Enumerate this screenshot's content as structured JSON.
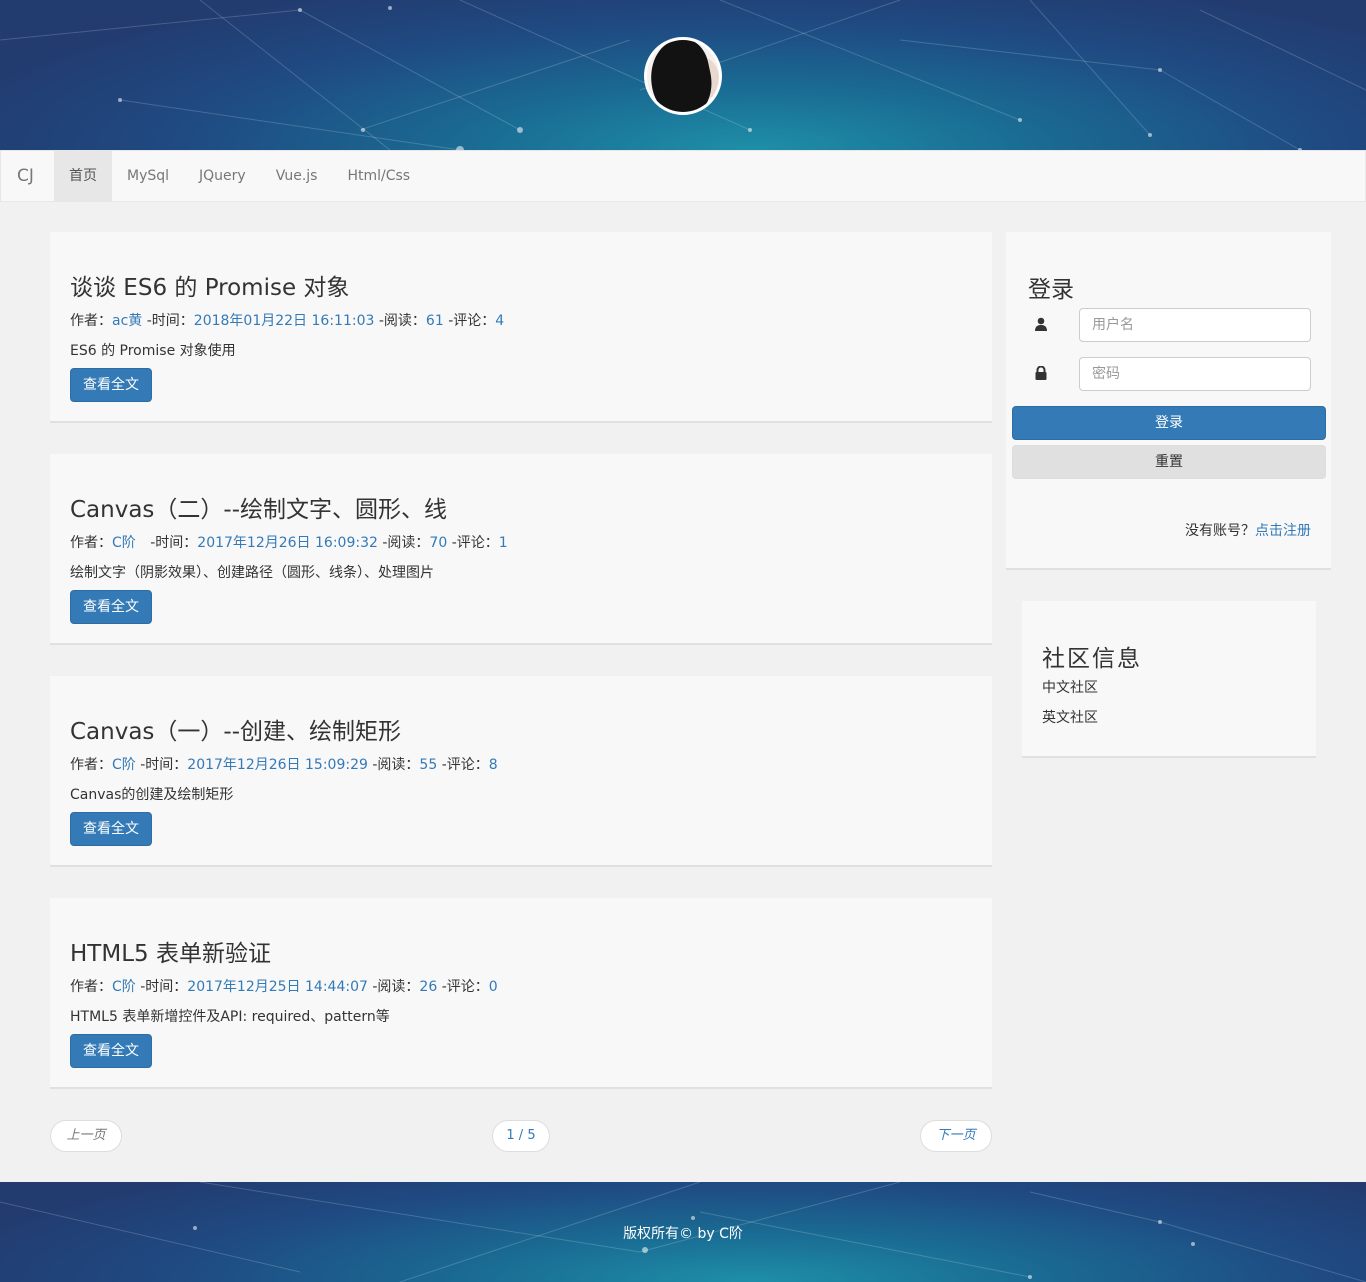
{
  "site": {
    "brand": "CJ",
    "nav": [
      {
        "label": "首页",
        "active": true
      },
      {
        "label": "MySql",
        "active": false
      },
      {
        "label": "JQuery",
        "active": false
      },
      {
        "label": "Vue.js",
        "active": false
      },
      {
        "label": "Html/Css",
        "active": false
      }
    ]
  },
  "articles": [
    {
      "title": "谈谈 ES6 的 Promise 对象",
      "author_label": "作者：",
      "author": "ac黄",
      "time_label": "-时间：",
      "time": "2018年01月22日 16:11:03",
      "reads_label": "-阅读：",
      "reads": "61",
      "comments_label": "-评论：",
      "comments": "4",
      "summary": "ES6 的 Promise 对象使用",
      "button": "查看全文"
    },
    {
      "title": "Canvas（二）--绘制文字、圆形、线",
      "author_label": "作者：",
      "author": "C阶",
      "time_label": "-时间：",
      "time": "2017年12月26日 16:09:32",
      "reads_label": "-阅读：",
      "reads": "70",
      "comments_label": "-评论：",
      "comments": "1",
      "summary": "绘制文字（阴影效果）、创建路径（圆形、线条）、处理图片",
      "button": "查看全文"
    },
    {
      "title": "Canvas（一）--创建、绘制矩形",
      "author_label": "作者：",
      "author": "C阶",
      "time_label": "-时间：",
      "time": "2017年12月26日 15:09:29",
      "reads_label": "-阅读：",
      "reads": "55",
      "comments_label": "-评论：",
      "comments": "8",
      "summary": "Canvas的创建及绘制矩形",
      "button": "查看全文"
    },
    {
      "title": "HTML5 表单新验证",
      "author_label": "作者：",
      "author": "C阶",
      "time_label": "-时间：",
      "time": "2017年12月25日 14:44:07",
      "reads_label": "-阅读：",
      "reads": "26",
      "comments_label": "-评论：",
      "comments": "0",
      "summary": "HTML5 表单新增控件及API: required、pattern等",
      "button": "查看全文"
    }
  ],
  "pager": {
    "prev": "上一页",
    "current": "1 / 5",
    "next": "下一页"
  },
  "login": {
    "title": "登录",
    "username_placeholder": "用户名",
    "password_placeholder": "密码",
    "login_button": "登录",
    "reset_button": "重置",
    "no_account": "没有账号？",
    "register_link": "点击注册"
  },
  "community": {
    "title": "社区信息",
    "items": [
      "中文社区",
      "英文社区"
    ]
  },
  "footer": {
    "copyright": "版权所有© by C阶"
  },
  "colors": {
    "primary": "#337ab7",
    "banner_dark": "#223c70",
    "banner_light": "#1e8fa8"
  }
}
